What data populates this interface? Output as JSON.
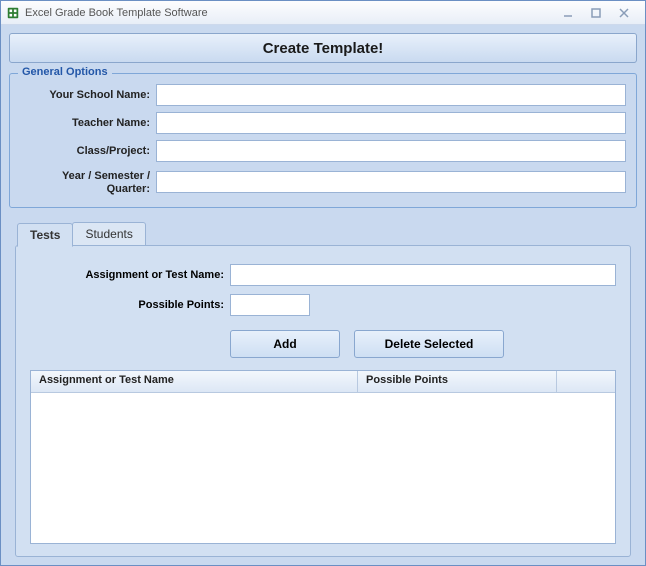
{
  "title": "Excel Grade Book Template Software",
  "createBtn": "Create Template!",
  "general": {
    "legend": "General Options",
    "schoolLabel": "Your School Name:",
    "teacherLabel": "Teacher Name:",
    "classLabel": "Class/Project:",
    "yearLabel": "Year / Semester / Quarter:",
    "school": "",
    "teacher": "",
    "classProject": "",
    "year": ""
  },
  "tabs": {
    "tests": "Tests",
    "students": "Students"
  },
  "testsPanel": {
    "assignLabel": "Assignment or Test Name:",
    "pointsLabel": "Possible Points:",
    "addBtn": "Add",
    "deleteBtn": "Delete Selected",
    "col1": "Assignment or Test Name",
    "col2": "Possible Points",
    "assignValue": "",
    "pointsValue": ""
  }
}
